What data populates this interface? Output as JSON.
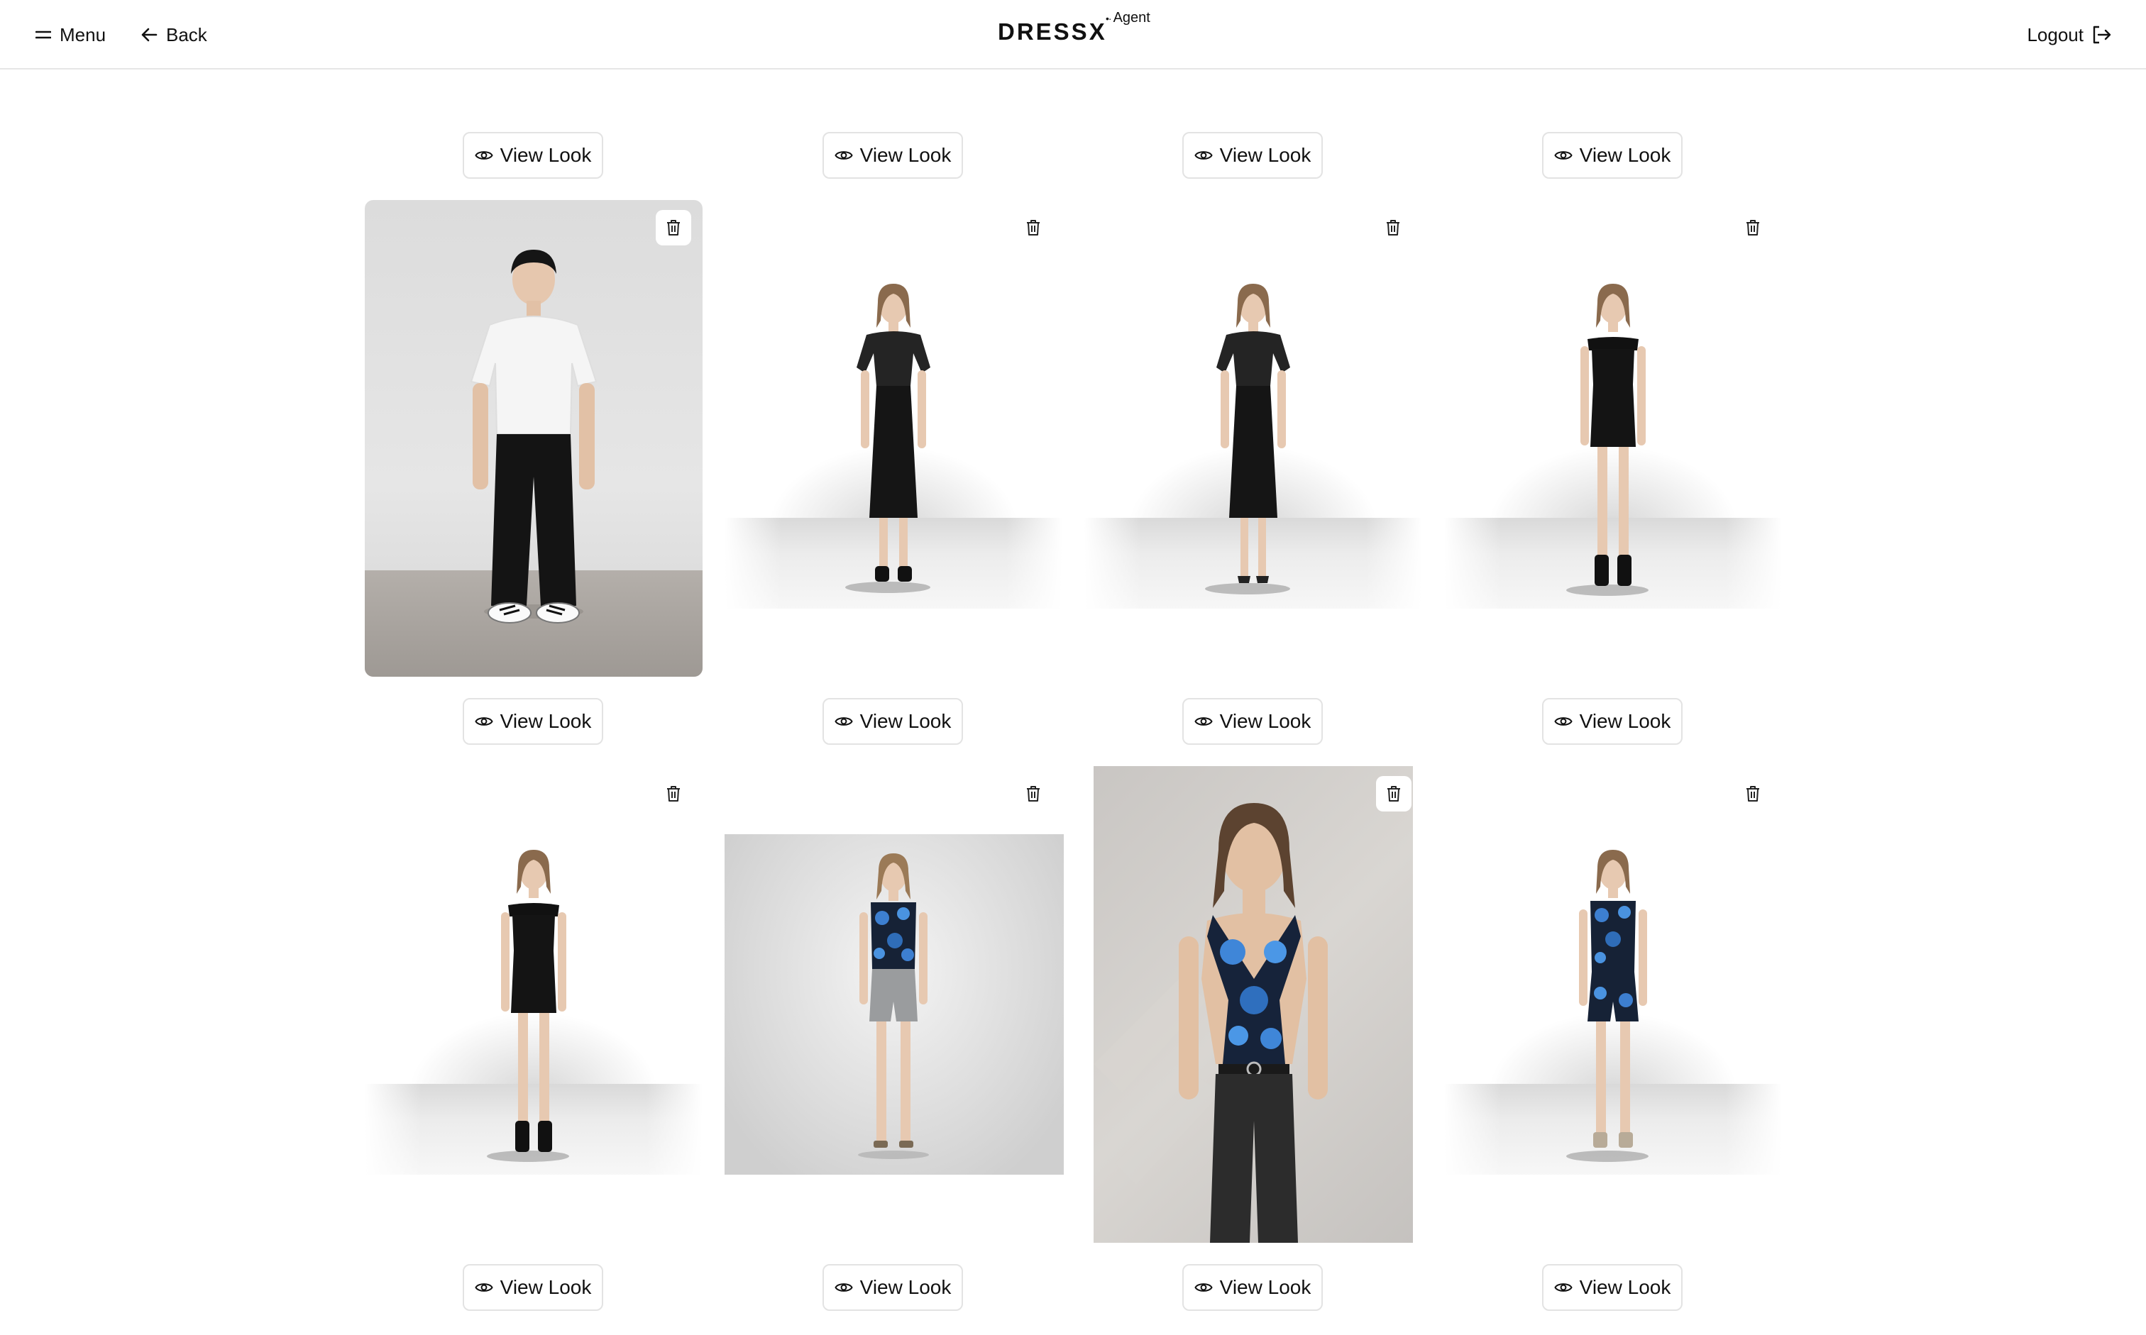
{
  "header": {
    "menu_label": "Menu",
    "back_label": "Back",
    "logo_text": "DRESSX",
    "logo_superscript": "Agent",
    "logout_label": "Logout"
  },
  "view_look_label": "View Look",
  "colors": {
    "text": "#111111",
    "border": "#e3e3e3",
    "background": "#ffffff"
  },
  "icons": {
    "menu": "menu-icon",
    "back": "arrow-left-icon",
    "logout": "logout-icon",
    "view": "eye-icon",
    "delete": "trash-icon"
  },
  "looks": [
    {
      "id": 1,
      "outfit": "white t-shirt, black trousers, sneakers"
    },
    {
      "id": 2,
      "outfit": "black off-shoulder puff-sleeve midi dress"
    },
    {
      "id": 3,
      "outfit": "black off-shoulder puff-sleeve midi dress with heels"
    },
    {
      "id": 4,
      "outfit": "black off-shoulder mini dress with boots"
    },
    {
      "id": 5,
      "outfit": "black off-shoulder mini dress with boots"
    },
    {
      "id": 6,
      "outfit": "blue floral halter top with grey shorts"
    },
    {
      "id": 7,
      "outfit": "blue floral halter top with dark trousers"
    },
    {
      "id": 8,
      "outfit": "blue floral halter top with floral shorts"
    }
  ]
}
